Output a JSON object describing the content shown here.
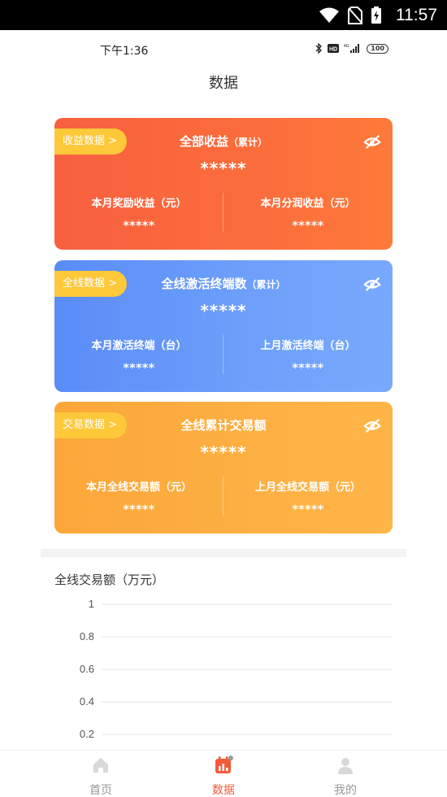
{
  "system_bar": {
    "time": "11:57"
  },
  "inner_status": {
    "time": "下午1:36",
    "battery": "100"
  },
  "page": {
    "title": "数据"
  },
  "cards": [
    {
      "tag": "收益数据 >",
      "title": "全部收益",
      "title_sub": "（累计）",
      "total": "*****",
      "left_label": "本月奖励收益（元）",
      "left_value": "*****",
      "right_label": "本月分润收益（元）",
      "right_value": "*****"
    },
    {
      "tag": "全线数据 >",
      "title": "全线激活终端数",
      "title_sub": "（累计）",
      "total": "*****",
      "left_label": "本月激活终端（台）",
      "left_value": "*****",
      "right_label": "上月激活终端（台）",
      "right_value": "*****"
    },
    {
      "tag": "交易数据 >",
      "title": "全线累计交易额",
      "title_sub": "",
      "total": "*****",
      "left_label": "本月全线交易额（元）",
      "left_value": "*****",
      "right_label": "上月全线交易额（元）",
      "right_value": "*****"
    }
  ],
  "chart": {
    "title": "全线交易额（万元）"
  },
  "chart_data": {
    "type": "line",
    "title": "全线交易额（万元）",
    "xlabel": "",
    "ylabel": "",
    "ylim": [
      0,
      1
    ],
    "y_ticks": [
      "1",
      "0.8",
      "0.6",
      "0.4",
      "0.2"
    ],
    "grid": true,
    "series": []
  },
  "tabbar": {
    "items": [
      {
        "label": "首页",
        "icon": "home-icon"
      },
      {
        "label": "数据",
        "icon": "data-calendar-icon"
      },
      {
        "label": "我的",
        "icon": "user-icon"
      }
    ],
    "active_color": "#f25b3a",
    "inactive_color": "#999999"
  },
  "colors": {
    "card_red": "#f96a3d",
    "card_blue": "#6a9bfa",
    "card_orange": "#fdad40",
    "tag_yellow": "#fdc83a"
  }
}
